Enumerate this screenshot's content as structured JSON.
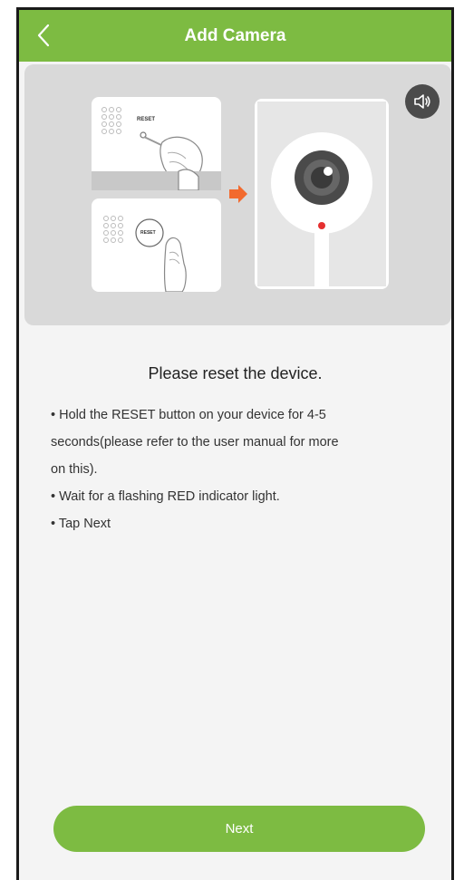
{
  "header": {
    "title": "Add Camera",
    "back_icon": "chevron-left-icon"
  },
  "illustration": {
    "speaker_icon": "speaker-icon",
    "reset_label_top": "RESET",
    "reset_label_button": "RESET",
    "arrow_color": "#f26a2e",
    "indicator_color": "#e53030"
  },
  "instructions": {
    "heading": "Please reset the device.",
    "steps": [
      "• Hold the RESET button on your device for 4-5",
      "seconds(please refer to the user manual for more",
      "on this).",
      "• Wait for a flashing RED indicator light.",
      "• Tap Next"
    ]
  },
  "footer": {
    "next_label": "Next"
  },
  "colors": {
    "accent": "#7dbb42",
    "background": "#f4f4f4",
    "illustration_bg": "#d9d9d9"
  }
}
